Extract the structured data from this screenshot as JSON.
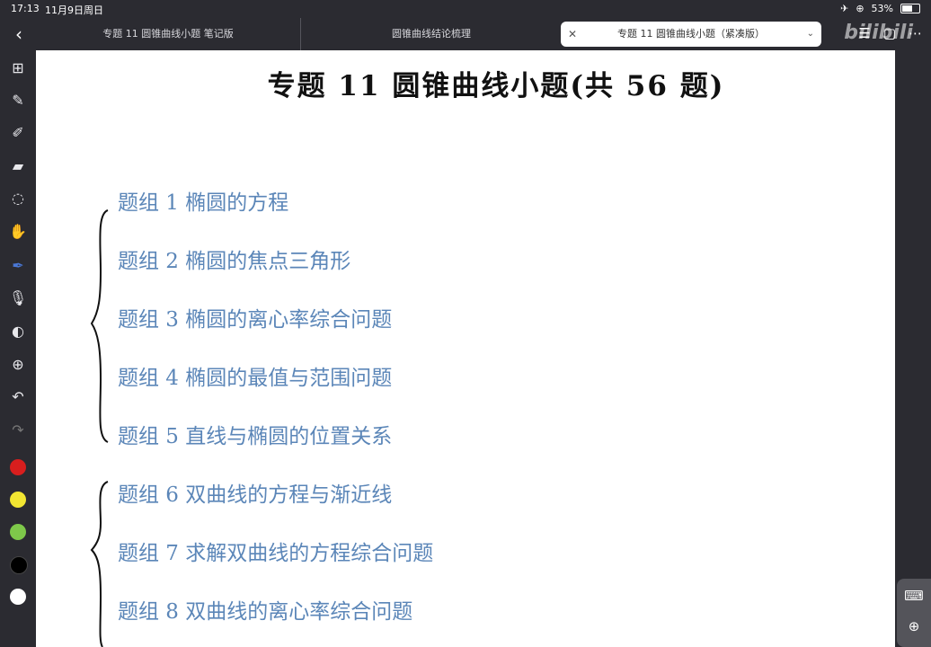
{
  "status": {
    "time": "17:13",
    "date": "11月9日周日",
    "battery": "53%"
  },
  "tabs": [
    {
      "label": "专题 11 圆锥曲线小题 笔记版"
    },
    {
      "label": "圆锥曲线结论梳理"
    },
    {
      "label": "专题 11 圆锥曲线小题（紧凑版）"
    }
  ],
  "watermark": "bilibili",
  "document": {
    "title": "专题 11    圆锥曲线小题(共 56 题)",
    "groups": [
      {
        "label": "题组 1  椭圆的方程"
      },
      {
        "label": "题组 2  椭圆的焦点三角形"
      },
      {
        "label": "题组 3  椭圆的离心率综合问题"
      },
      {
        "label": "题组 4  椭圆的最值与范围问题"
      },
      {
        "label": "题组 5  直线与椭圆的位置关系"
      },
      {
        "label": "题组 6  双曲线的方程与渐近线"
      },
      {
        "label": "题组 7  求解双曲线的方程综合问题"
      },
      {
        "label": "题组 8  双曲线的离心率综合问题"
      }
    ]
  },
  "toolbar": {
    "tools": [
      "grid-icon",
      "pen-icon",
      "highlighter-icon",
      "eraser-icon",
      "lasso-icon",
      "hand-icon",
      "laser-pointer-icon",
      "microphone-icon",
      "shape-icon",
      "add-icon",
      "undo-icon",
      "redo-icon"
    ],
    "colors": [
      "#d81e1e",
      "#f2e632",
      "#7ec84a",
      "#000000",
      "#ffffff"
    ]
  },
  "colors": {
    "accent_text": "#5b86b8",
    "ink": "#111111"
  }
}
